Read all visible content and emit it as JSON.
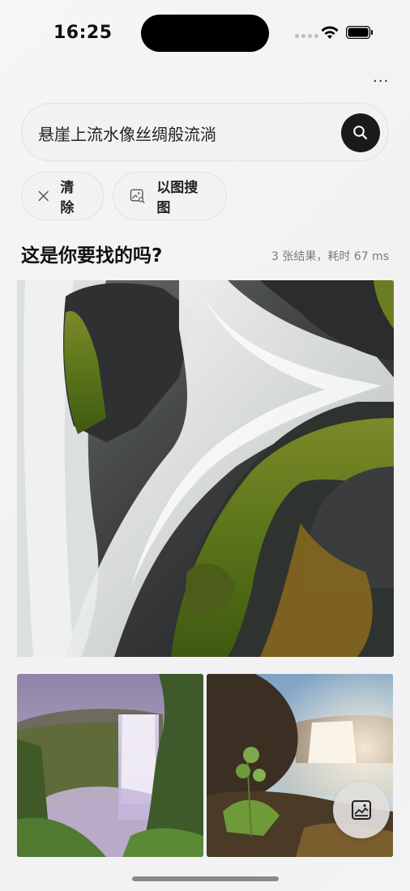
{
  "status_bar": {
    "time": "16:25"
  },
  "search": {
    "query": "悬崖上流水像丝绸般流淌"
  },
  "actions": {
    "clear_label": "清除",
    "image_search_label": "以图搜图"
  },
  "results": {
    "title": "这是你要找的吗?",
    "meta": "3 张结果，耗时 67 ms"
  },
  "images": [
    {
      "icon": "waterfall-closeup-photo"
    },
    {
      "icon": "purple-waterfall-photo"
    },
    {
      "icon": "sunlit-waterfall-photo"
    }
  ],
  "colors": {
    "accent": "#1a1a1a",
    "moss": "#5c7a1c"
  }
}
